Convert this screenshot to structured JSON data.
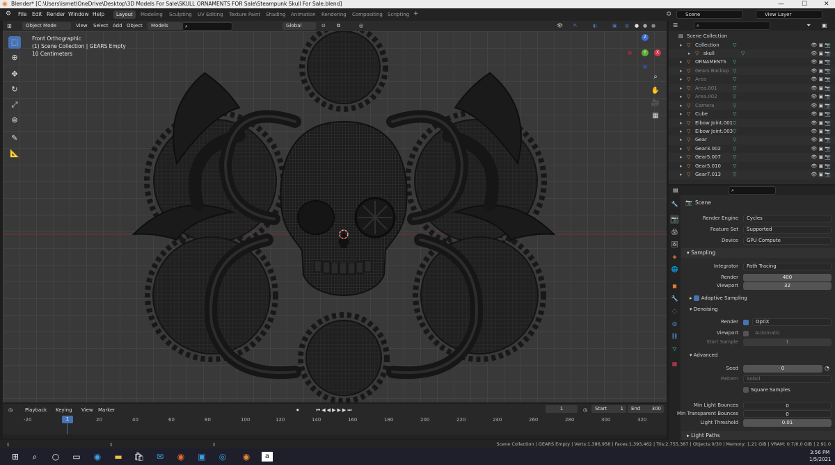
{
  "titlebar": {
    "title": "Blender* [C:\\Users\\ismet\\OneDrive\\Desktop\\3D Models For Sale\\SKULL ORNAMENTS FOR Sale\\Steampunk Skull For Sale.blend]",
    "minimize": "—",
    "maximize": "☐",
    "close": "✕"
  },
  "menu": [
    "File",
    "Edit",
    "Render",
    "Window",
    "Help"
  ],
  "workspaces": [
    "Layout",
    "Modeling",
    "Sculpting",
    "UV Editing",
    "Texture Paint",
    "Shading",
    "Animation",
    "Rendering",
    "Compositing",
    "Scripting"
  ],
  "scene_field": "Scene",
  "view_layer_field": "View Layer",
  "viewport_header": {
    "mode": "Object Mode",
    "view": "View",
    "select": "Select",
    "add": "Add",
    "object": "Object",
    "models": "Models",
    "orientation": "Global"
  },
  "viewport_overlay": {
    "view_name": "Front Orthographic",
    "context": "(1) Scene Collection | GEARS Empty",
    "scale": "10 Centimeters"
  },
  "gizmo": {
    "z": "Z",
    "x": "X",
    "y": "Y"
  },
  "outliner": {
    "root": "Scene Collection",
    "rows": [
      {
        "name": "Collection",
        "indent": 1
      },
      {
        "name": "skull",
        "indent": 2
      },
      {
        "name": "ORNAMENTS",
        "indent": 1
      },
      {
        "name": "Gears Backup",
        "indent": 1,
        "dim": true
      },
      {
        "name": "Area",
        "indent": 1,
        "dim": true
      },
      {
        "name": "Area.001",
        "indent": 1,
        "dim": true
      },
      {
        "name": "Area.002",
        "indent": 1,
        "dim": true
      },
      {
        "name": "Camera",
        "indent": 1,
        "dim": true
      },
      {
        "name": "Cube",
        "indent": 1
      },
      {
        "name": "Elbow Joint.001",
        "indent": 1
      },
      {
        "name": "Elbow Joint.003",
        "indent": 1
      },
      {
        "name": "Gear",
        "indent": 1
      },
      {
        "name": "Gear3.002",
        "indent": 1
      },
      {
        "name": "Gear5.007",
        "indent": 1
      },
      {
        "name": "Gear5.010",
        "indent": 1
      },
      {
        "name": "Gear7.013",
        "indent": 1
      }
    ]
  },
  "properties": {
    "scene_label": "Scene",
    "render_engine": {
      "label": "Render Engine",
      "value": "Cycles"
    },
    "feature_set": {
      "label": "Feature Set",
      "value": "Supported"
    },
    "device": {
      "label": "Device",
      "value": "GPU Compute"
    },
    "sampling": "Sampling",
    "integrator": {
      "label": "Integrator",
      "value": "Path Tracing"
    },
    "render_samples": {
      "label": "Render",
      "value": "400"
    },
    "viewport_samples": {
      "label": "Viewport",
      "value": "32"
    },
    "adaptive_sampling": "Adaptive Sampling",
    "denoising": "Denoising",
    "denoise_render": {
      "label": "Render",
      "value": "OptiX"
    },
    "denoise_viewport": {
      "label": "Viewport",
      "value": "Automatic"
    },
    "start_sample": {
      "label": "Start Sample",
      "value": "1"
    },
    "advanced": "Advanced",
    "seed": {
      "label": "Seed",
      "value": "0"
    },
    "pattern": {
      "label": "Pattern",
      "value": "Sobol"
    },
    "square_samples": "Square Samples",
    "min_light_bounces": {
      "label": "Min Light Bounces",
      "value": "0"
    },
    "min_transparent_bounces": {
      "label": "Min Transparent Bounces",
      "value": "0"
    },
    "light_threshold": {
      "label": "Light Threshold",
      "value": "0.01"
    },
    "light_paths": "Light Paths"
  },
  "timeline": {
    "playback": "Playback",
    "keying": "Keying",
    "view": "View",
    "marker": "Marker",
    "current_frame": "1",
    "start_label": "Start",
    "start": "1",
    "end_label": "End",
    "end": "300",
    "ticks": [
      "-20",
      "1",
      "20",
      "40",
      "60",
      "80",
      "100",
      "120",
      "140",
      "160",
      "180",
      "200",
      "220",
      "240",
      "260",
      "280",
      "300",
      "320"
    ]
  },
  "statusbar": "Scene Collection | GEARS Empty | Verts:1,386,958 | Faces:1,393,462 | Tris:2,755,387 | Objects:0/30 | Memory: 1.21 GiB | VRAM: 0.7/6.0 GiB | 2.91.0",
  "taskbar": {
    "time": "3:56 PM",
    "date": "1/5/2021"
  },
  "colors": {
    "accent": "#4772b3",
    "object_orange": "#e8883a",
    "mesh_green": "#56c98a"
  }
}
